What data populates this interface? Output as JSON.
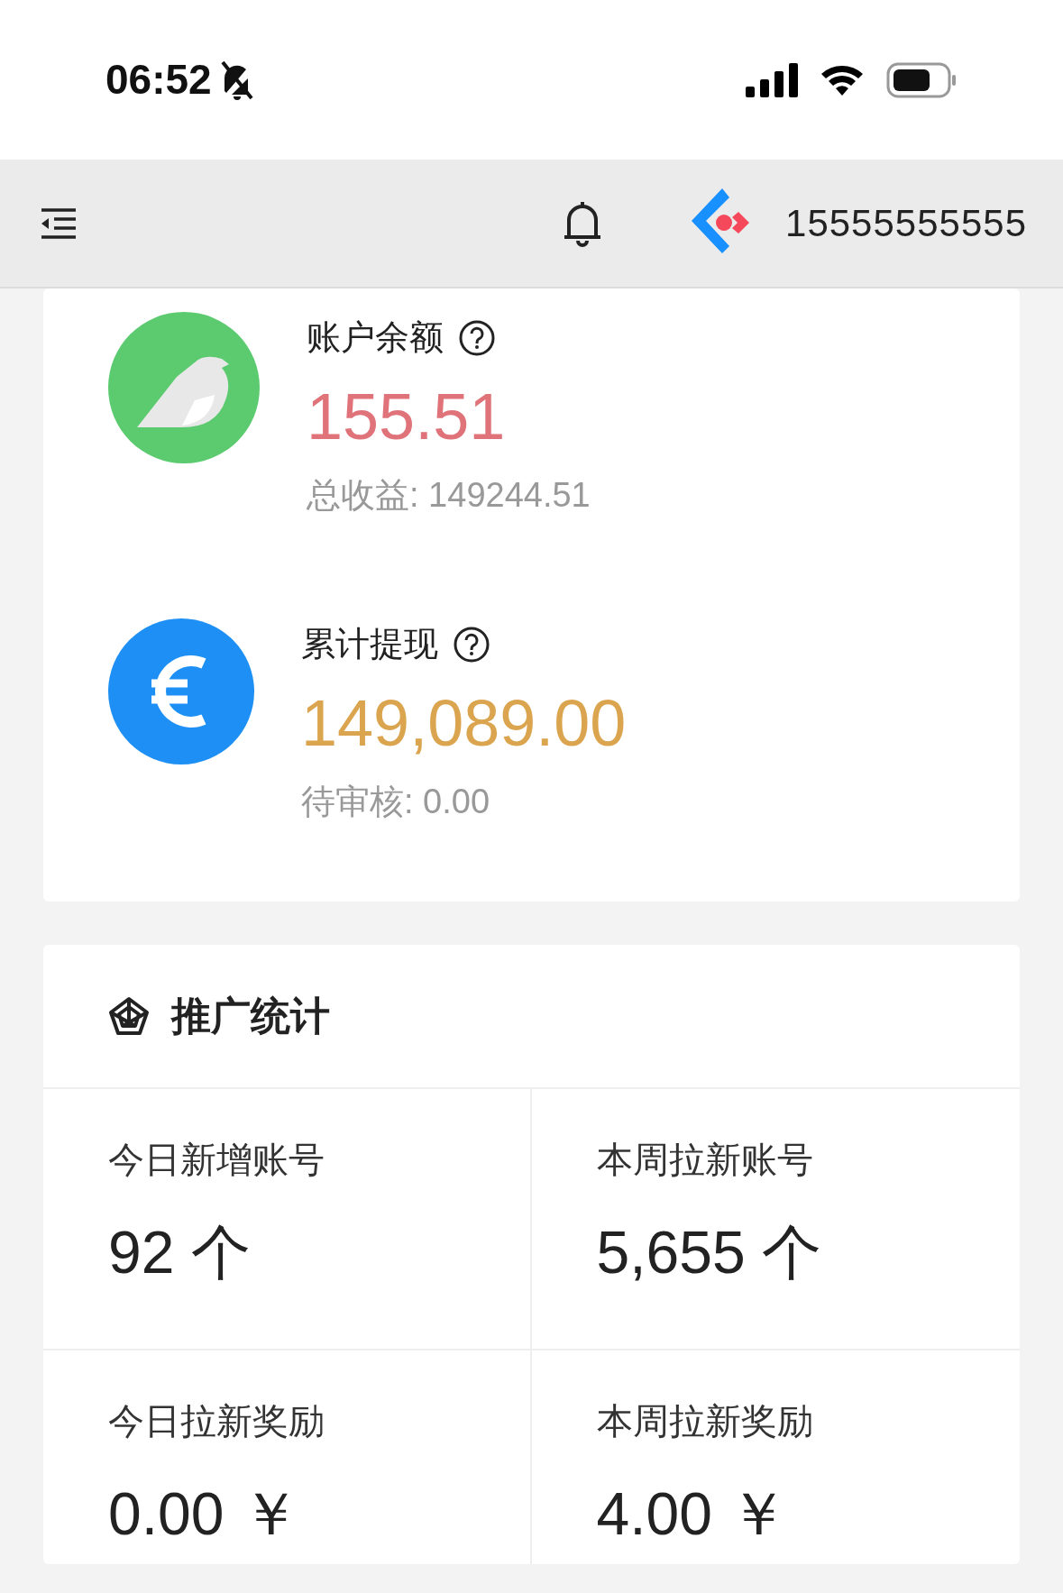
{
  "status_bar": {
    "time": "06:52",
    "silent": true
  },
  "header": {
    "phone": "15555555555"
  },
  "balances": [
    {
      "kind": "bird",
      "label": "账户余额",
      "amount": "155.51",
      "color": "#e0737a",
      "sub": "总收益: 149244.51"
    },
    {
      "kind": "euro",
      "label": "累计提现",
      "amount": "149,089.00",
      "color": "#dba54f",
      "sub": "待审核: 0.00"
    }
  ],
  "promotion": {
    "title": "推广统计",
    "stats": [
      {
        "label": "今日新增账号",
        "value": "92 个"
      },
      {
        "label": "本周拉新账号",
        "value": "5,655 个"
      },
      {
        "label": "今日拉新奖励",
        "value": "0.00 ￥"
      },
      {
        "label": "本周拉新奖励",
        "value": "4.00 ￥"
      }
    ]
  }
}
